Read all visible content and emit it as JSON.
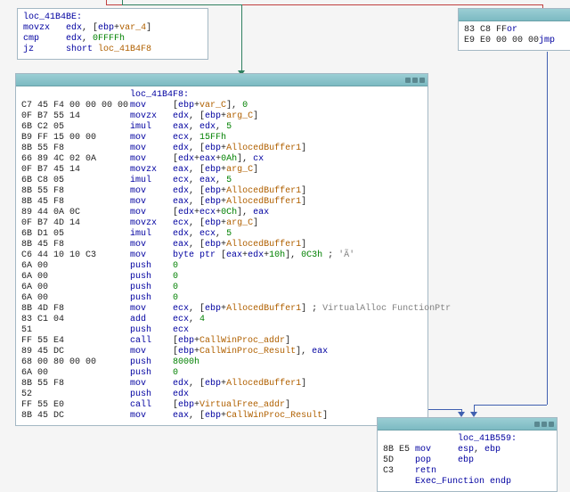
{
  "nodes": {
    "top": {
      "loc": "loc_41B4BE:",
      "rows": [
        {
          "mnem": "movzx",
          "ops": [
            {
              "t": "reg",
              "v": "edx"
            },
            {
              "t": "tx",
              "v": ", ["
            },
            {
              "t": "reg",
              "v": "ebp"
            },
            {
              "t": "tx",
              "v": "+"
            },
            {
              "t": "var",
              "v": "var_4"
            },
            {
              "t": "tx",
              "v": "]"
            }
          ]
        },
        {
          "mnem": "cmp",
          "ops": [
            {
              "t": "reg",
              "v": "edx"
            },
            {
              "t": "tx",
              "v": ", "
            },
            {
              "t": "num",
              "v": "0FFFFh"
            }
          ]
        },
        {
          "mnem": "jz",
          "ops": [
            {
              "t": "lit",
              "v": "short"
            },
            {
              "t": "tx",
              "v": " "
            },
            {
              "t": "var",
              "v": "loc_41B4F8"
            }
          ]
        }
      ]
    },
    "right": {
      "rows": [
        {
          "bytes": "83 C8 FF",
          "mnem": "or"
        },
        {
          "bytes": "E9 E0 00 00 00",
          "mnem": "jmp"
        }
      ]
    },
    "main": {
      "loc": "loc_41B4F8:",
      "rows": [
        {
          "bytes": "C7 45 F4 00 00 00 00",
          "mnem": "mov",
          "ops": [
            {
              "t": "tx",
              "v": "["
            },
            {
              "t": "reg",
              "v": "ebp"
            },
            {
              "t": "tx",
              "v": "+"
            },
            {
              "t": "var",
              "v": "var_C"
            },
            {
              "t": "tx",
              "v": "], "
            },
            {
              "t": "num",
              "v": "0"
            }
          ]
        },
        {
          "bytes": "0F B7 55 14",
          "mnem": "movzx",
          "ops": [
            {
              "t": "reg",
              "v": "edx"
            },
            {
              "t": "tx",
              "v": ", ["
            },
            {
              "t": "reg",
              "v": "ebp"
            },
            {
              "t": "tx",
              "v": "+"
            },
            {
              "t": "var",
              "v": "arg_C"
            },
            {
              "t": "tx",
              "v": "]"
            }
          ]
        },
        {
          "bytes": "6B C2 05",
          "mnem": "imul",
          "ops": [
            {
              "t": "reg",
              "v": "eax"
            },
            {
              "t": "tx",
              "v": ", "
            },
            {
              "t": "reg",
              "v": "edx"
            },
            {
              "t": "tx",
              "v": ", "
            },
            {
              "t": "num",
              "v": "5"
            }
          ]
        },
        {
          "bytes": "B9 FF 15 00 00",
          "mnem": "mov",
          "ops": [
            {
              "t": "reg",
              "v": "ecx"
            },
            {
              "t": "tx",
              "v": ", "
            },
            {
              "t": "num",
              "v": "15FFh"
            }
          ]
        },
        {
          "bytes": "8B 55 F8",
          "mnem": "mov",
          "ops": [
            {
              "t": "reg",
              "v": "edx"
            },
            {
              "t": "tx",
              "v": ", ["
            },
            {
              "t": "reg",
              "v": "ebp"
            },
            {
              "t": "tx",
              "v": "+"
            },
            {
              "t": "var",
              "v": "AllocedBuffer1"
            },
            {
              "t": "tx",
              "v": "]"
            }
          ]
        },
        {
          "bytes": "66 89 4C 02 0A",
          "mnem": "mov",
          "ops": [
            {
              "t": "tx",
              "v": "["
            },
            {
              "t": "reg",
              "v": "edx"
            },
            {
              "t": "tx",
              "v": "+"
            },
            {
              "t": "reg",
              "v": "eax"
            },
            {
              "t": "tx",
              "v": "+"
            },
            {
              "t": "num",
              "v": "0Ah"
            },
            {
              "t": "tx",
              "v": "], "
            },
            {
              "t": "reg",
              "v": "cx"
            }
          ]
        },
        {
          "bytes": "0F B7 45 14",
          "mnem": "movzx",
          "ops": [
            {
              "t": "reg",
              "v": "eax"
            },
            {
              "t": "tx",
              "v": ", ["
            },
            {
              "t": "reg",
              "v": "ebp"
            },
            {
              "t": "tx",
              "v": "+"
            },
            {
              "t": "var",
              "v": "arg_C"
            },
            {
              "t": "tx",
              "v": "]"
            }
          ]
        },
        {
          "bytes": "6B C8 05",
          "mnem": "imul",
          "ops": [
            {
              "t": "reg",
              "v": "ecx"
            },
            {
              "t": "tx",
              "v": ", "
            },
            {
              "t": "reg",
              "v": "eax"
            },
            {
              "t": "tx",
              "v": ", "
            },
            {
              "t": "num",
              "v": "5"
            }
          ]
        },
        {
          "bytes": "8B 55 F8",
          "mnem": "mov",
          "ops": [
            {
              "t": "reg",
              "v": "edx"
            },
            {
              "t": "tx",
              "v": ", ["
            },
            {
              "t": "reg",
              "v": "ebp"
            },
            {
              "t": "tx",
              "v": "+"
            },
            {
              "t": "var",
              "v": "AllocedBuffer1"
            },
            {
              "t": "tx",
              "v": "]"
            }
          ]
        },
        {
          "bytes": "8B 45 F8",
          "mnem": "mov",
          "ops": [
            {
              "t": "reg",
              "v": "eax"
            },
            {
              "t": "tx",
              "v": ", ["
            },
            {
              "t": "reg",
              "v": "ebp"
            },
            {
              "t": "tx",
              "v": "+"
            },
            {
              "t": "var",
              "v": "AllocedBuffer1"
            },
            {
              "t": "tx",
              "v": "]"
            }
          ]
        },
        {
          "bytes": "89 44 0A 0C",
          "mnem": "mov",
          "ops": [
            {
              "t": "tx",
              "v": "["
            },
            {
              "t": "reg",
              "v": "edx"
            },
            {
              "t": "tx",
              "v": "+"
            },
            {
              "t": "reg",
              "v": "ecx"
            },
            {
              "t": "tx",
              "v": "+"
            },
            {
              "t": "num",
              "v": "0Ch"
            },
            {
              "t": "tx",
              "v": "], "
            },
            {
              "t": "reg",
              "v": "eax"
            }
          ]
        },
        {
          "bytes": "0F B7 4D 14",
          "mnem": "movzx",
          "ops": [
            {
              "t": "reg",
              "v": "ecx"
            },
            {
              "t": "tx",
              "v": ", ["
            },
            {
              "t": "reg",
              "v": "ebp"
            },
            {
              "t": "tx",
              "v": "+"
            },
            {
              "t": "var",
              "v": "arg_C"
            },
            {
              "t": "tx",
              "v": "]"
            }
          ]
        },
        {
          "bytes": "6B D1 05",
          "mnem": "imul",
          "ops": [
            {
              "t": "reg",
              "v": "edx"
            },
            {
              "t": "tx",
              "v": ", "
            },
            {
              "t": "reg",
              "v": "ecx"
            },
            {
              "t": "tx",
              "v": ", "
            },
            {
              "t": "num",
              "v": "5"
            }
          ]
        },
        {
          "bytes": "8B 45 F8",
          "mnem": "mov",
          "ops": [
            {
              "t": "reg",
              "v": "eax"
            },
            {
              "t": "tx",
              "v": ", ["
            },
            {
              "t": "reg",
              "v": "ebp"
            },
            {
              "t": "tx",
              "v": "+"
            },
            {
              "t": "var",
              "v": "AllocedBuffer1"
            },
            {
              "t": "tx",
              "v": "]"
            }
          ]
        },
        {
          "bytes": "C6 44 10 10 C3",
          "mnem": "mov",
          "ops": [
            {
              "t": "lit",
              "v": "byte ptr"
            },
            {
              "t": "tx",
              "v": " ["
            },
            {
              "t": "reg",
              "v": "eax"
            },
            {
              "t": "tx",
              "v": "+"
            },
            {
              "t": "reg",
              "v": "edx"
            },
            {
              "t": "tx",
              "v": "+"
            },
            {
              "t": "num",
              "v": "10h"
            },
            {
              "t": "tx",
              "v": "], "
            },
            {
              "t": "num",
              "v": "0C3h"
            },
            {
              "t": "tx",
              "v": " ; "
            },
            {
              "t": "cmt",
              "v": "'Ã'"
            }
          ]
        },
        {
          "bytes": "6A 00",
          "mnem": "push",
          "ops": [
            {
              "t": "num",
              "v": "0"
            }
          ]
        },
        {
          "bytes": "6A 00",
          "mnem": "push",
          "ops": [
            {
              "t": "num",
              "v": "0"
            }
          ]
        },
        {
          "bytes": "6A 00",
          "mnem": "push",
          "ops": [
            {
              "t": "num",
              "v": "0"
            }
          ]
        },
        {
          "bytes": "6A 00",
          "mnem": "push",
          "ops": [
            {
              "t": "num",
              "v": "0"
            }
          ]
        },
        {
          "bytes": "8B 4D F8",
          "mnem": "mov",
          "ops": [
            {
              "t": "reg",
              "v": "ecx"
            },
            {
              "t": "tx",
              "v": ", ["
            },
            {
              "t": "reg",
              "v": "ebp"
            },
            {
              "t": "tx",
              "v": "+"
            },
            {
              "t": "var",
              "v": "AllocedBuffer1"
            },
            {
              "t": "tx",
              "v": "] ; "
            },
            {
              "t": "cmt",
              "v": "VirtualAlloc FunctionPtr"
            }
          ]
        },
        {
          "bytes": "83 C1 04",
          "mnem": "add",
          "ops": [
            {
              "t": "reg",
              "v": "ecx"
            },
            {
              "t": "tx",
              "v": ", "
            },
            {
              "t": "num",
              "v": "4"
            }
          ]
        },
        {
          "bytes": "51",
          "mnem": "push",
          "ops": [
            {
              "t": "reg",
              "v": "ecx"
            }
          ]
        },
        {
          "bytes": "FF 55 E4",
          "mnem": "call",
          "ops": [
            {
              "t": "tx",
              "v": "["
            },
            {
              "t": "reg",
              "v": "ebp"
            },
            {
              "t": "tx",
              "v": "+"
            },
            {
              "t": "var",
              "v": "CallWinProc_addr"
            },
            {
              "t": "tx",
              "v": "]"
            }
          ]
        },
        {
          "bytes": "89 45 DC",
          "mnem": "mov",
          "ops": [
            {
              "t": "tx",
              "v": "["
            },
            {
              "t": "reg",
              "v": "ebp"
            },
            {
              "t": "tx",
              "v": "+"
            },
            {
              "t": "var",
              "v": "CallWinProc_Result"
            },
            {
              "t": "tx",
              "v": "], "
            },
            {
              "t": "reg",
              "v": "eax"
            }
          ]
        },
        {
          "bytes": "68 00 80 00 00",
          "mnem": "push",
          "ops": [
            {
              "t": "num",
              "v": "8000h"
            }
          ]
        },
        {
          "bytes": "6A 00",
          "mnem": "push",
          "ops": [
            {
              "t": "num",
              "v": "0"
            }
          ]
        },
        {
          "bytes": "8B 55 F8",
          "mnem": "mov",
          "ops": [
            {
              "t": "reg",
              "v": "edx"
            },
            {
              "t": "tx",
              "v": ", ["
            },
            {
              "t": "reg",
              "v": "ebp"
            },
            {
              "t": "tx",
              "v": "+"
            },
            {
              "t": "var",
              "v": "AllocedBuffer1"
            },
            {
              "t": "tx",
              "v": "]"
            }
          ]
        },
        {
          "bytes": "52",
          "mnem": "push",
          "ops": [
            {
              "t": "reg",
              "v": "edx"
            }
          ]
        },
        {
          "bytes": "FF 55 E0",
          "mnem": "call",
          "ops": [
            {
              "t": "tx",
              "v": "["
            },
            {
              "t": "reg",
              "v": "ebp"
            },
            {
              "t": "tx",
              "v": "+"
            },
            {
              "t": "var",
              "v": "VirtualFree_addr"
            },
            {
              "t": "tx",
              "v": "]"
            }
          ]
        },
        {
          "bytes": "8B 45 DC",
          "mnem": "mov",
          "ops": [
            {
              "t": "reg",
              "v": "eax"
            },
            {
              "t": "tx",
              "v": ", ["
            },
            {
              "t": "reg",
              "v": "ebp"
            },
            {
              "t": "tx",
              "v": "+"
            },
            {
              "t": "var",
              "v": "CallWinProc_Result"
            },
            {
              "t": "tx",
              "v": "]"
            }
          ]
        }
      ]
    },
    "bottom": {
      "loc": "loc_41B559:",
      "endp": "Exec_Function endp",
      "rows": [
        {
          "bytes": "8B E5",
          "mnem": "mov",
          "ops": [
            {
              "t": "reg",
              "v": "esp"
            },
            {
              "t": "tx",
              "v": ", "
            },
            {
              "t": "reg",
              "v": "ebp"
            }
          ]
        },
        {
          "bytes": "5D",
          "mnem": "pop",
          "ops": [
            {
              "t": "reg",
              "v": "ebp"
            }
          ]
        },
        {
          "bytes": "C3",
          "mnem": "retn",
          "ops": []
        }
      ]
    }
  }
}
